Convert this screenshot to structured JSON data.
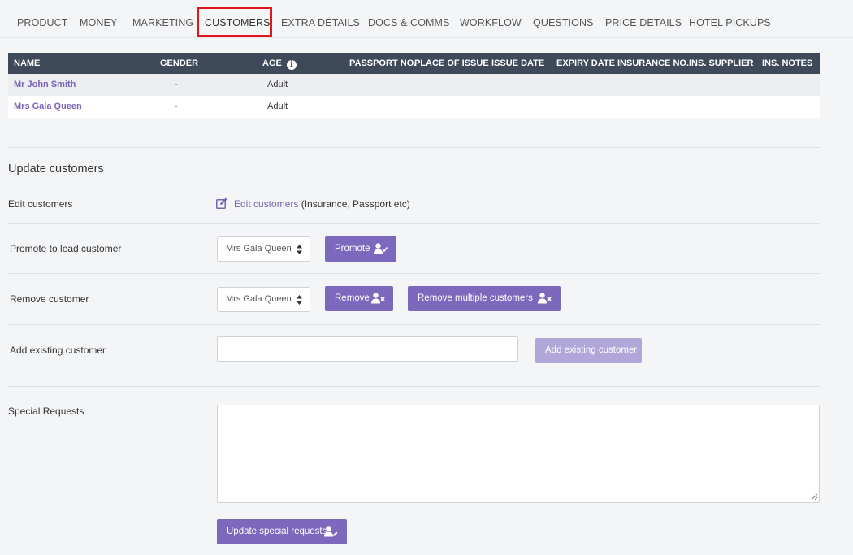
{
  "tabs": [
    {
      "label": "PRODUCT"
    },
    {
      "label": "MONEY"
    },
    {
      "label": "MARKETING"
    },
    {
      "label": "CUSTOMERS"
    },
    {
      "label": "EXTRA DETAILS"
    },
    {
      "label": "DOCS & COMMS"
    },
    {
      "label": "WORKFLOW"
    },
    {
      "label": "QUESTIONS"
    },
    {
      "label": "PRICE DETAILS"
    },
    {
      "label": "HOTEL PICKUPS"
    }
  ],
  "active_tab": "CUSTOMERS",
  "table": {
    "headers": {
      "name": "NAME",
      "gender": "GENDER",
      "age": "AGE",
      "passport": "PASSPORT NO.",
      "place": "PLACE OF ISSUE",
      "issue": "ISSUE DATE",
      "expiry": "EXPIRY DATE",
      "insurance": "INSURANCE NO.",
      "supplier": "INS. SUPPLIER",
      "notes": "INS. NOTES"
    },
    "rows": [
      {
        "name": "Mr John Smith",
        "gender": "-",
        "age": "Adult"
      },
      {
        "name": "Mrs Gala Queen",
        "gender": "-",
        "age": "Adult"
      }
    ]
  },
  "update": {
    "title": "Update customers",
    "edit_label": "Edit customers",
    "edit_link": "Edit customers",
    "edit_note": " (Insurance, Passport etc)",
    "promote_label": "Promote to lead customer",
    "promote_select": "Mrs Gala Queen",
    "promote_button": "Promote",
    "remove_label": "Remove customer",
    "remove_select": "Mrs Gala Queen",
    "remove_button": "Remove",
    "remove_multiple_button": "Remove multiple customers",
    "add_existing_label": "Add existing customer",
    "add_existing_value": "",
    "add_existing_button": "Add existing customer",
    "special_requests_label": "Special Requests",
    "special_requests_value": "",
    "update_special_button": "Update special requests"
  },
  "colors": {
    "accent": "#7c68bd",
    "header_bg": "#3e4a5a",
    "highlight": "#e0161e"
  }
}
